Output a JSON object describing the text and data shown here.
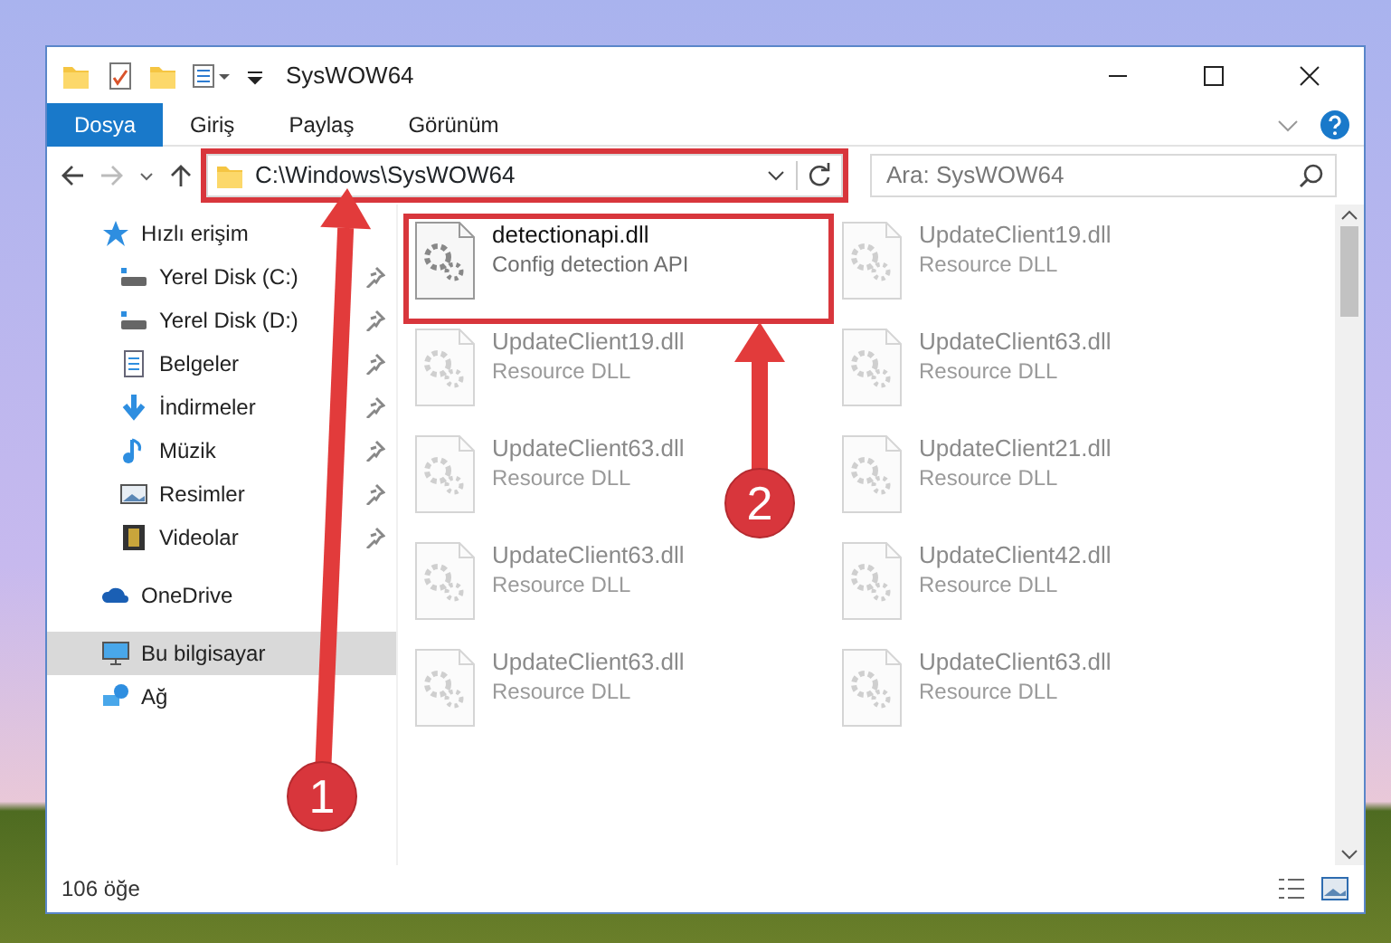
{
  "window": {
    "title": "SysWOW64"
  },
  "ribbon_tabs": [
    {
      "label": "Dosya",
      "selected": true
    },
    {
      "label": "Giriş",
      "selected": false
    },
    {
      "label": "Paylaş",
      "selected": false
    },
    {
      "label": "Görünüm",
      "selected": false
    }
  ],
  "address": {
    "path": "C:\\Windows\\SysWOW64",
    "highlighted": true
  },
  "search": {
    "placeholder": "Ara: SysWOW64"
  },
  "sidebar": {
    "items": [
      {
        "label": "Hızlı erişim",
        "kind": "star",
        "pinned": false,
        "selected": false,
        "children": [
          {
            "label": "Yerel Disk (C:)",
            "kind": "drive",
            "pinned": true,
            "selected": false
          },
          {
            "label": "Yerel Disk (D:)",
            "kind": "drive",
            "pinned": true,
            "selected": false
          },
          {
            "label": "Belgeler",
            "kind": "document",
            "pinned": true,
            "selected": false
          },
          {
            "label": "İndirmeler",
            "kind": "download",
            "pinned": true,
            "selected": false
          },
          {
            "label": "Müzik",
            "kind": "music",
            "pinned": true,
            "selected": false
          },
          {
            "label": "Resimler",
            "kind": "picture",
            "pinned": true,
            "selected": false
          },
          {
            "label": "Videolar",
            "kind": "video",
            "pinned": true,
            "selected": false
          }
        ]
      },
      {
        "label": "OneDrive",
        "kind": "cloud",
        "pinned": false,
        "selected": false
      },
      {
        "label": "Bu bilgisayar",
        "kind": "computer",
        "pinned": false,
        "selected": true
      },
      {
        "label": "Ağ",
        "kind": "network",
        "pinned": false,
        "selected": false
      }
    ]
  },
  "files": [
    {
      "name": "detectionapi.dll",
      "description": "Config detection API",
      "faded": false,
      "highlighted": true
    },
    {
      "name": "UpdateClient19.dll",
      "description": "Resource DLL",
      "faded": true,
      "highlighted": false
    },
    {
      "name": "UpdateClient63.dll",
      "description": "Resource DLL",
      "faded": true,
      "highlighted": false
    },
    {
      "name": "UpdateClient63.dll",
      "description": "Resource DLL",
      "faded": true,
      "highlighted": false
    },
    {
      "name": "UpdateClient63.dll",
      "description": "Resource DLL",
      "faded": true,
      "highlighted": false
    },
    {
      "name": "UpdateClient19.dll",
      "description": "Resource DLL",
      "faded": true,
      "highlighted": false
    },
    {
      "name": "UpdateClient63.dll",
      "description": "Resource DLL",
      "faded": true,
      "highlighted": false
    },
    {
      "name": "UpdateClient21.dll",
      "description": "Resource DLL",
      "faded": true,
      "highlighted": false
    },
    {
      "name": "UpdateClient42.dll",
      "description": "Resource DLL",
      "faded": true,
      "highlighted": false
    },
    {
      "name": "UpdateClient63.dll",
      "description": "Resource DLL",
      "faded": true,
      "highlighted": false
    }
  ],
  "status_bar": {
    "count": "106 öğe"
  },
  "annotations": [
    {
      "label": "1"
    },
    {
      "label": "2"
    }
  ]
}
